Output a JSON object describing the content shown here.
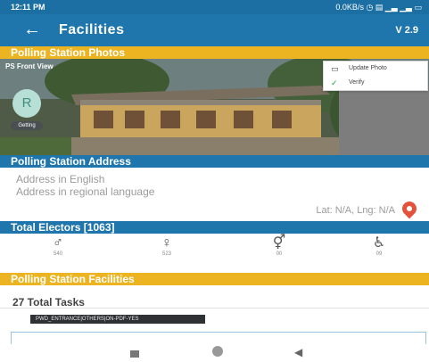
{
  "status_bar": {
    "time": "12:11 PM",
    "right": "0.0KB/s ◷ ▤ ▁▃ ▁▃ ▭"
  },
  "app_bar": {
    "back_icon": "arrow-left-icon",
    "title": "Facilities",
    "version": "V 2.9"
  },
  "photos": {
    "header": "Polling Station Photos",
    "photo_label": "PS Front View",
    "avatar_letter": "R",
    "avatar_tag": "Getting",
    "menu": [
      {
        "label": "Update Photo",
        "icon": "camera-icon",
        "glyph": "▭"
      },
      {
        "label": "Verify",
        "icon": "check-icon",
        "glyph": "✓"
      }
    ]
  },
  "address": {
    "header": "Polling Station Address",
    "line_english": "Address in English",
    "line_regional": "Address in regional language",
    "latlng": "Lat: N/A, Lng: N/A",
    "map_icon": "map-pin-icon"
  },
  "electors": {
    "header": "Total Electors [1063]",
    "items": [
      {
        "icon": "male-icon",
        "glyph": "♂",
        "count": "540"
      },
      {
        "icon": "female-icon",
        "glyph": "♀",
        "count": "523"
      },
      {
        "icon": "third-gender-icon",
        "glyph": "⚥",
        "count": "00"
      },
      {
        "icon": "pwd-icon",
        "glyph": "♿",
        "count": "09"
      }
    ]
  },
  "facilities": {
    "header": "Polling Station Facilities",
    "tasks": "27 Total Tasks",
    "chip": "PWD_ENTRANCE|OTHERS|ON-PDF-YES"
  },
  "nav": {
    "recent_icon": "recent-apps-icon",
    "home_icon": "home-icon",
    "back_icon": "back-triangle-icon"
  },
  "colors": {
    "primary": "#1e76ad",
    "accent": "#ecb420"
  }
}
